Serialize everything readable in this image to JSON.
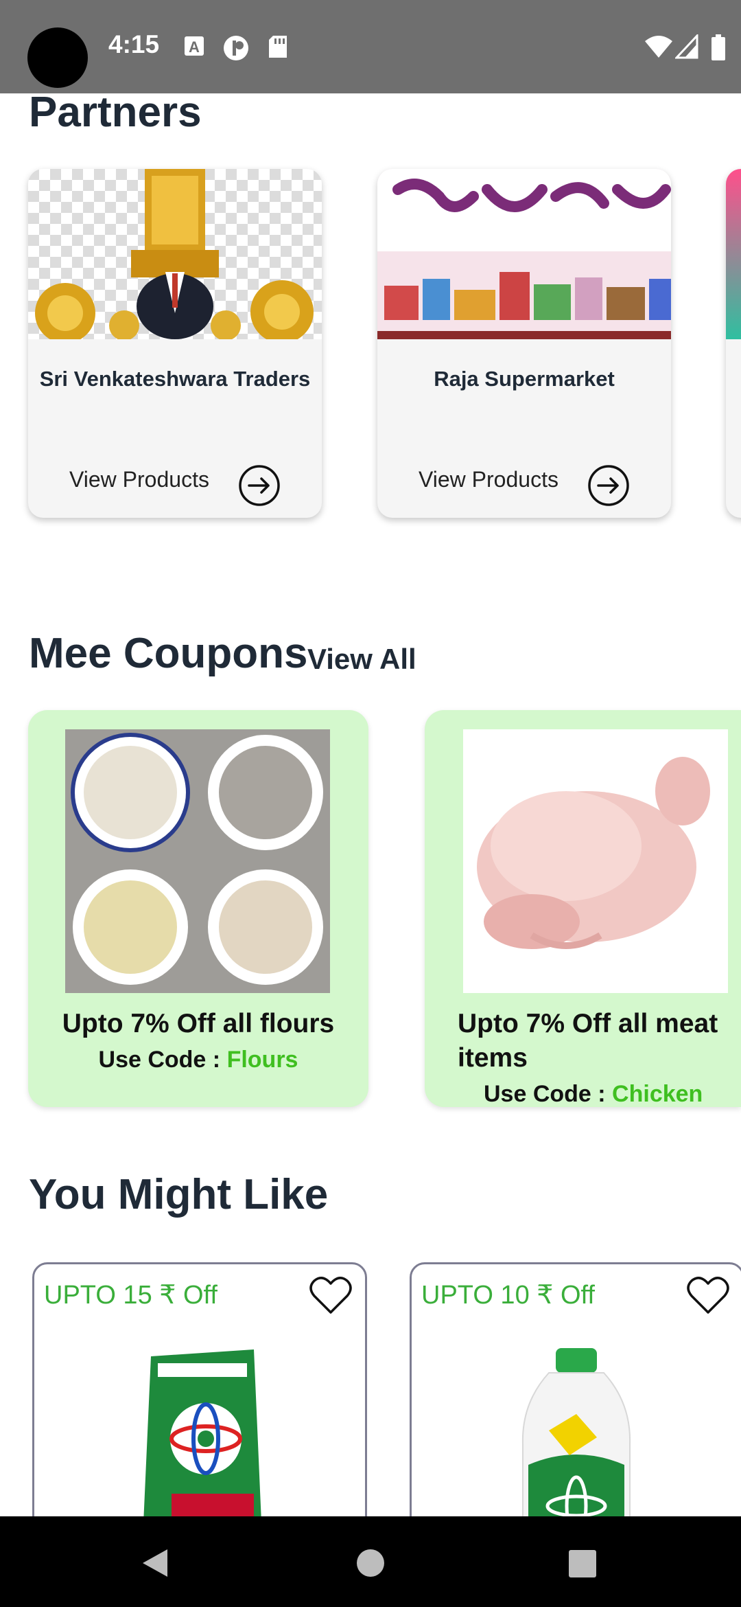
{
  "status_bar": {
    "time": "4:15",
    "icons": [
      "text-a-icon",
      "data-saver-icon",
      "sd-card-icon",
      "wifi-icon",
      "signal-icon",
      "battery-icon"
    ]
  },
  "partners": {
    "title": "Partners",
    "items": [
      {
        "name": "Sri Venkateshwara Traders",
        "action": "View Products",
        "image": "deity-image"
      },
      {
        "name": "Raja Supermarket",
        "action": "View Products",
        "image": "supermarket-banner-image"
      }
    ]
  },
  "coupons": {
    "title": "Mee Coupons",
    "view_all": "View All",
    "code_label": "Use Code : ",
    "items": [
      {
        "title": "Upto 7% Off all flours",
        "code": "Flours",
        "image": "flour-bowls-image"
      },
      {
        "title": "Upto 7% Off all meat items",
        "code": "Chicken",
        "image": "chicken-image"
      }
    ]
  },
  "recommendations": {
    "title": "You Might Like",
    "items": [
      {
        "discount": "UPTO 15 ₹ Off",
        "image": "detergent-pack-image"
      },
      {
        "discount": "UPTO 10 ₹ Off",
        "image": "detergent-bottle-image"
      }
    ]
  },
  "colors": {
    "status_bar": "#6f6f6f",
    "heading": "#1f2a37",
    "coupon_bg": "#d4f8cd",
    "code_green": "#3fbf20",
    "discount_green": "#3aae3a"
  },
  "nav_bar": {
    "buttons": [
      "back-icon",
      "home-icon",
      "recents-icon"
    ]
  }
}
